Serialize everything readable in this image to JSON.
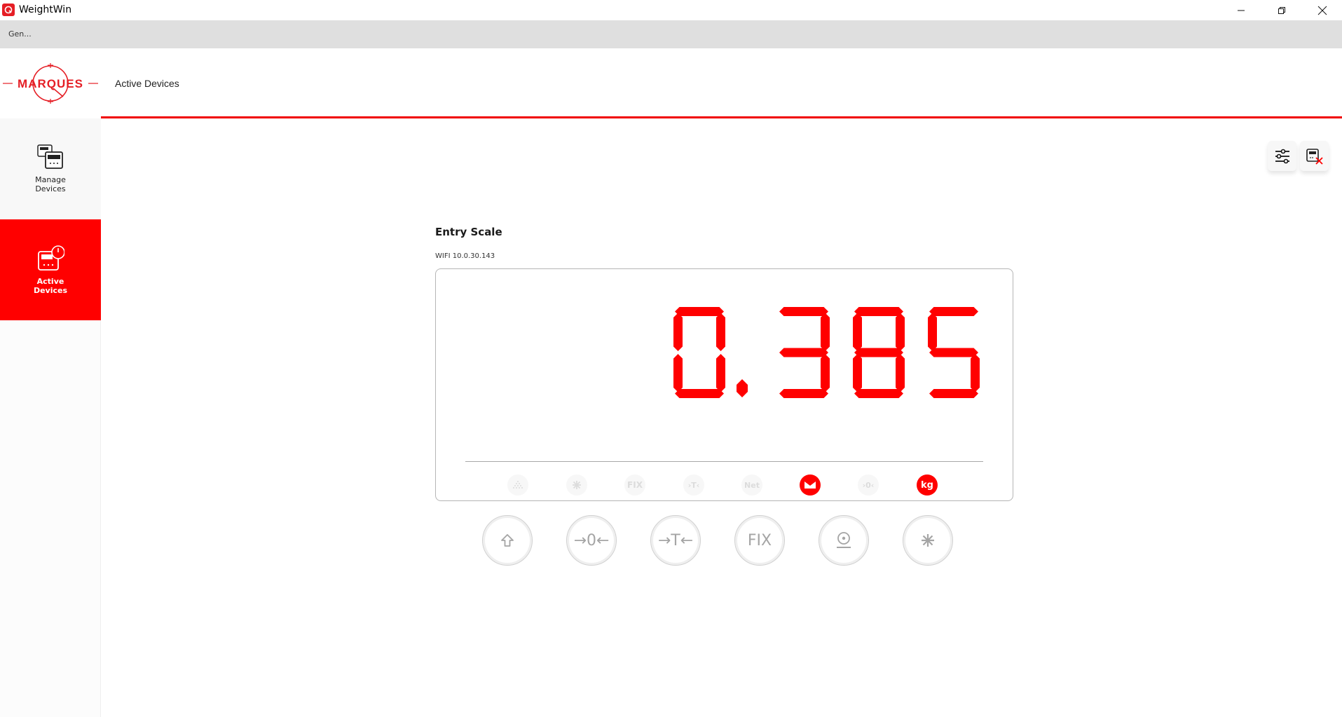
{
  "window": {
    "title": "WeightWin",
    "icon": "app-logo-icon",
    "controls": [
      "minimize-icon",
      "restore-icon",
      "close-icon"
    ]
  },
  "menubar": {
    "items": [
      {
        "label": "Gen..."
      }
    ]
  },
  "header": {
    "logo_text": "MARQUES",
    "title": "Active Devices",
    "accent_color": "#f00000"
  },
  "sidebar": {
    "items": [
      {
        "label_line1": "Manage",
        "label_line2": "Devices",
        "icon": "manage-devices-icon",
        "active": false
      },
      {
        "label_line1": "Active",
        "label_line2": "Devices",
        "icon": "active-devices-icon",
        "active": true
      }
    ]
  },
  "toolbar": {
    "buttons": [
      {
        "name": "settings",
        "icon": "sliders-icon"
      },
      {
        "name": "disconnect",
        "icon": "device-remove-icon"
      }
    ]
  },
  "device": {
    "name": "Entry Scale",
    "connection": "WIFI 10.0.30.143",
    "weight": "0.385",
    "display_color": "#ff0000",
    "indicators": [
      {
        "name": "range",
        "label": "",
        "icon": "dots-triangle-icon",
        "on": false
      },
      {
        "name": "star",
        "label": "",
        "icon": "asterisk-icon",
        "on": false
      },
      {
        "name": "fix",
        "label": "FIX",
        "on": false
      },
      {
        "name": "tare",
        "label": "›T‹",
        "on": false
      },
      {
        "name": "net",
        "label": "Net",
        "on": false
      },
      {
        "name": "stable",
        "label": "",
        "icon": "stable-icon",
        "on": true
      },
      {
        "name": "zero",
        "label": "›0‹",
        "on": false
      },
      {
        "name": "unit",
        "label": "kg",
        "on": true
      }
    ],
    "keys": [
      {
        "name": "shift",
        "label": "",
        "icon": "arrow-up-outline-icon"
      },
      {
        "name": "zero",
        "label": "→0←"
      },
      {
        "name": "tare",
        "label": "→T←"
      },
      {
        "name": "fix",
        "label": "FIX"
      },
      {
        "name": "print",
        "label": "",
        "icon": "target-underline-icon"
      },
      {
        "name": "function",
        "label": "",
        "icon": "asterisk-icon"
      }
    ]
  }
}
